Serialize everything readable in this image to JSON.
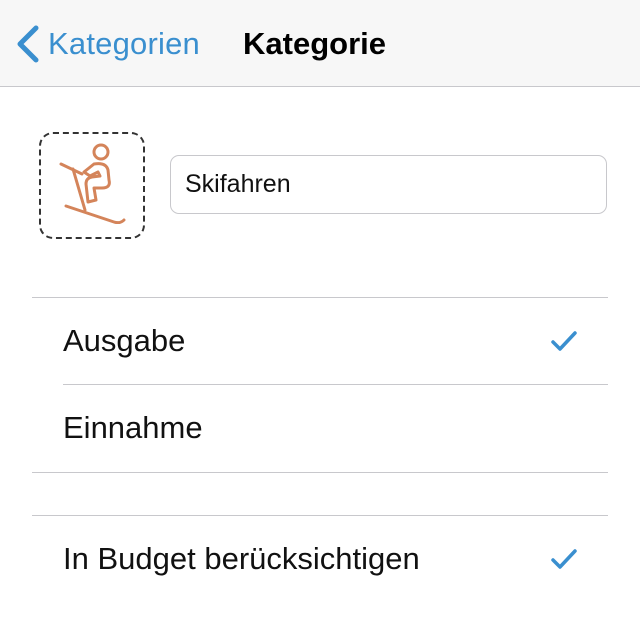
{
  "navbar": {
    "back_label": "Kategorien",
    "back_icon": "chevron-left-icon",
    "title": "Kategorie",
    "accent_color": "#3a8fcf"
  },
  "category": {
    "icon": "skier-icon",
    "icon_color": "#d4845a",
    "name_value": "Skifahren"
  },
  "type_options": [
    {
      "label": "Ausgabe",
      "selected": true
    },
    {
      "label": "Einnahme",
      "selected": false
    }
  ],
  "budget": {
    "label": "In Budget berücksichtigen",
    "checked": true
  }
}
